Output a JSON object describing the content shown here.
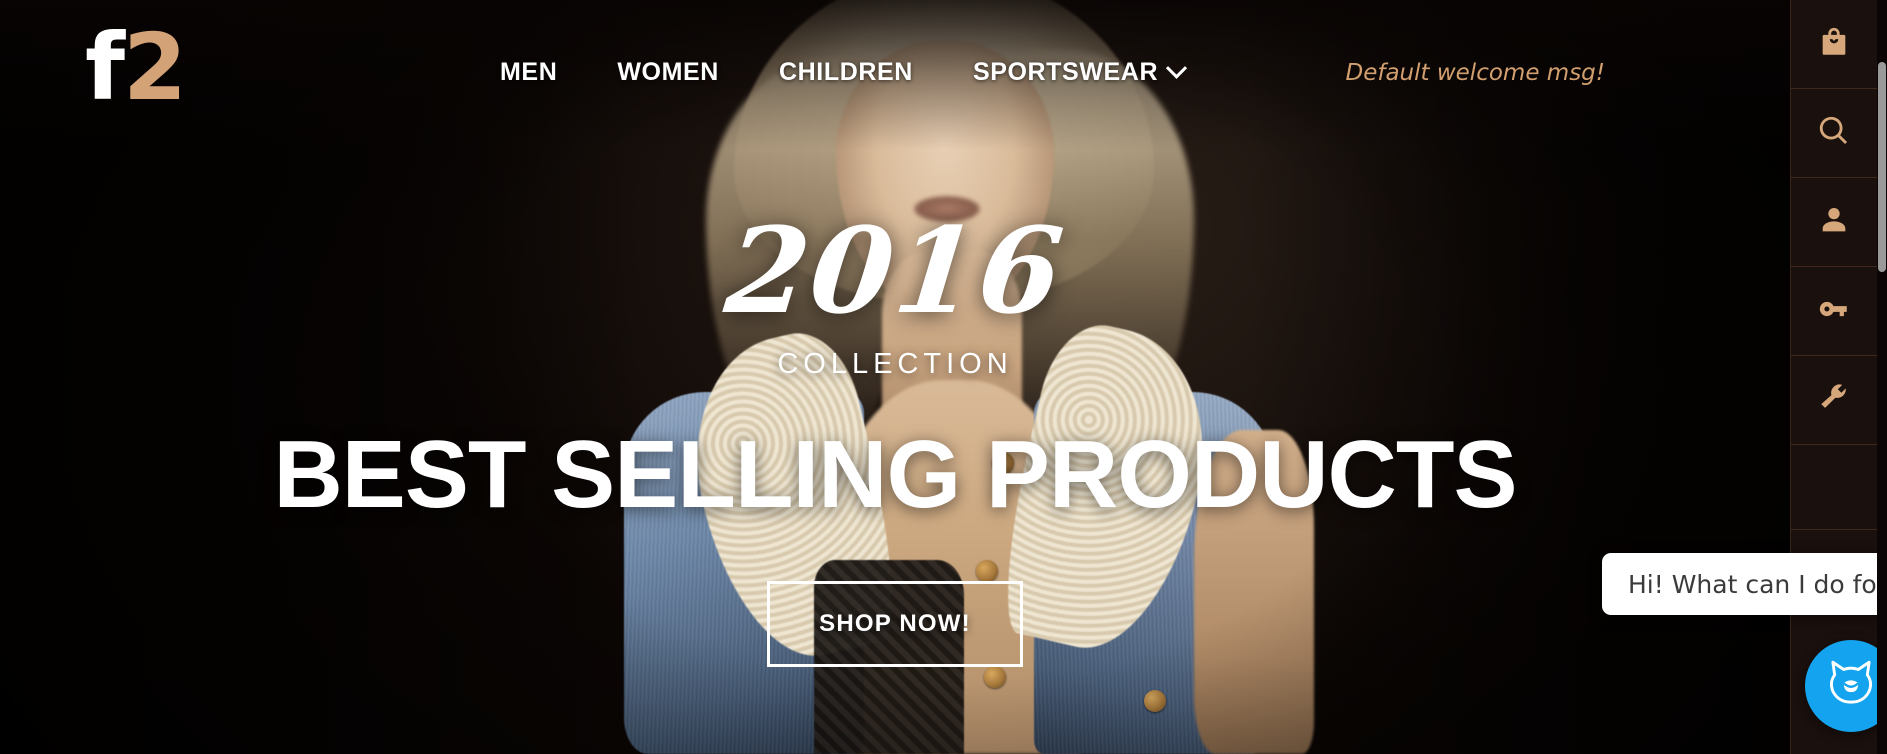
{
  "header": {
    "logo": {
      "part1": "f",
      "part2": "2"
    },
    "nav_items": [
      {
        "label": "MEN",
        "has_dropdown": false
      },
      {
        "label": "WOMEN",
        "has_dropdown": false
      },
      {
        "label": "CHILDREN",
        "has_dropdown": false
      },
      {
        "label": "SPORTSWEAR",
        "has_dropdown": true
      }
    ],
    "welcome_message": "Default welcome msg!"
  },
  "hero": {
    "year": "2016",
    "subtitle": "COLLECTION",
    "headline": "BEST SELLING PRODUCTS",
    "cta_label": "SHOP NOW!"
  },
  "sidebar": {
    "items": [
      {
        "icon": "shopping-bag-icon",
        "name": "cart"
      },
      {
        "icon": "search-icon",
        "name": "search"
      },
      {
        "icon": "user-icon",
        "name": "account"
      },
      {
        "icon": "key-icon",
        "name": "login"
      },
      {
        "icon": "wrench-icon",
        "name": "settings"
      }
    ]
  },
  "chat": {
    "message": "Hi! What can I do for you?",
    "avatar_icon": "chat-cat-icon"
  },
  "colors": {
    "accent_gold": "#d3a377",
    "sidebar_bg": "#1a100d",
    "page_bg": "#0d0604",
    "chat_blue": "#14a3ee",
    "text_white": "#ffffff"
  }
}
